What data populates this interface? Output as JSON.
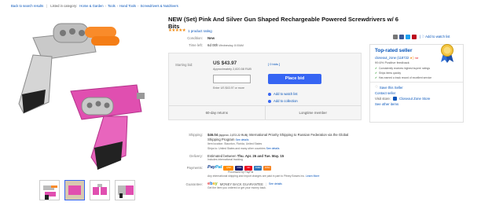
{
  "breadcrumb": {
    "back": "Back to search results",
    "listed": "Listed in category:",
    "items": [
      "Home & Garden",
      "Tools",
      "Hand Tools",
      "Screwdrivers & Nutdrivers"
    ]
  },
  "product": {
    "title": "NEW (Set) Pink And Silver Gun Shaped Rechargeable Powered Screwdrivers w/ 6 Bits",
    "stars": "★★★★★",
    "rating_text": "1 product rating"
  },
  "social": {
    "watch": "Add to watch list"
  },
  "details": {
    "condition_label": "Condition:",
    "condition": "New",
    "time_label": "Time left:",
    "time": "6d 00h",
    "time_detail": "Wednesday, 8:00AM"
  },
  "bid": {
    "label": "Starting bid:",
    "price": "US $43.97",
    "approx": "Approximately 2,820.58 RUB",
    "bids": "[ 0 bids ]",
    "input_value": "",
    "enter_hint": "Enter US $43.97 or more",
    "place_bid": "Place bid",
    "watch": "Add to watch list",
    "collection": "Add to collection",
    "returns": "60-day returns",
    "member": "Longtime member"
  },
  "seller": {
    "heading": "Top-rated seller",
    "name": "closeout_zone (118722",
    "feedback": "99.6% Positive feedback",
    "points": [
      "Consistently receives highest buyers' ratings",
      "Ships items quickly",
      "Has earned a track record of excellent service"
    ],
    "save": "Save this Seller",
    "contact": "Contact seller",
    "visit_label": "Visit store:",
    "store": "Closeout Zone Store",
    "other": "See other items"
  },
  "shipping": {
    "label": "Shipping:",
    "price": "$46.04",
    "approx": "(approx. 2,872.22 RUB)",
    "service": "International Priority Shipping to Russian Federation",
    "via": "via the Global Shipping Program",
    "see": "See details",
    "location": "Item location: Staunton, Florida, United States",
    "ships_to": "Ships to: United States and many other countries",
    "see2": "See details"
  },
  "delivery": {
    "label": "Delivery:",
    "estimated": "Estimated between",
    "dates": "Thu. Apr. 26 and Tue. May. 15",
    "tracking": "Includes international tracking"
  },
  "payments": {
    "label": "Payments:",
    "paypal_a": "Pay",
    "paypal_b": "Pal",
    "qiwi": "QIWI",
    "visa": "VISA",
    "mc": "MC",
    "amex": "AMEX",
    "disc": "DISC",
    "processed": "Processed by PayPal",
    "fees": "Any international shipping and import charges are paid in part to Pitney Bowes Inc.",
    "learn": "Learn More"
  },
  "guarantee": {
    "label": "Guarantee:",
    "e": "e",
    "b": "b",
    "a": "a",
    "y": "y",
    "mbg": "MONEY BACK GUARANTEE",
    "see": "See details",
    "text": "Get the item you ordered or get your money back."
  },
  "colors": {
    "accent": "#3665f3",
    "link": "#0654ba",
    "pink": "#e04fb0",
    "orange": "#f98b2a"
  }
}
